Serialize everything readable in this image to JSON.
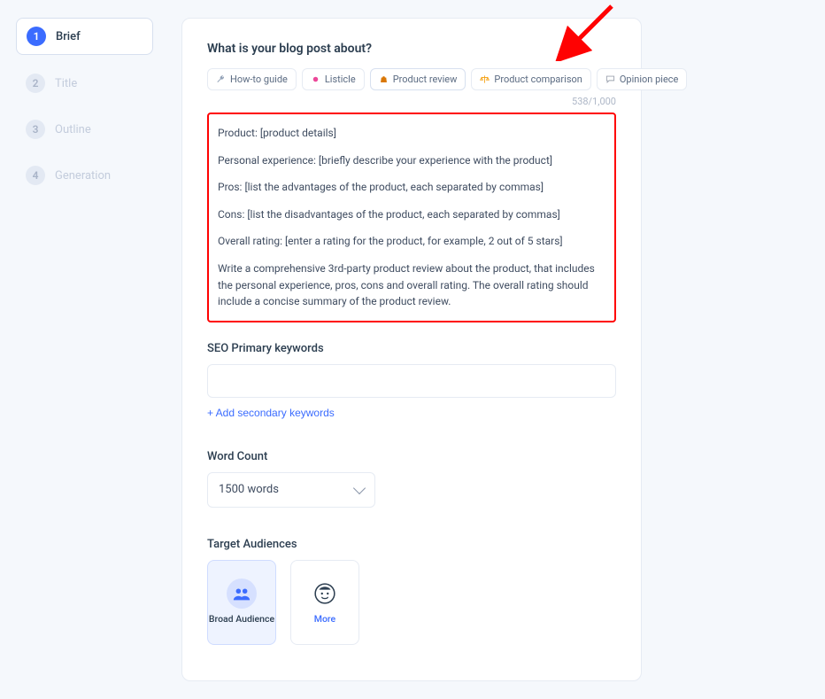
{
  "sidebar": {
    "steps": [
      {
        "num": "1",
        "label": "Brief",
        "active": true
      },
      {
        "num": "2",
        "label": "Title",
        "active": false
      },
      {
        "num": "3",
        "label": "Outline",
        "active": false
      },
      {
        "num": "4",
        "label": "Generation",
        "active": false
      }
    ]
  },
  "brief": {
    "title": "What is your blog post about?",
    "types": [
      {
        "label": "How-to guide",
        "icon": "wrench",
        "color": "#94a3b8"
      },
      {
        "label": "Listicle",
        "icon": "dot",
        "color": "#ec4899"
      },
      {
        "label": "Product review",
        "icon": "bag",
        "color": "#d97706",
        "selected": true
      },
      {
        "label": "Product comparison",
        "icon": "scales",
        "color": "#f59e0b"
      },
      {
        "label": "Opinion piece",
        "icon": "chat",
        "color": "#9ca3af"
      }
    ],
    "char_count": "538/1,000",
    "content": [
      "Product: [product details]",
      "Personal experience: [briefly describe your experience with the product]",
      "Pros: [list the advantages of the product, each separated by commas]",
      "Cons: [list the disadvantages of the product, each separated by commas]",
      "Overall rating: [enter a rating for the product, for example, 2 out of 5 stars]",
      "Write a comprehensive 3rd-party product review about the product, that includes the personal experience, pros, cons and overall rating.  The overall rating should include a concise summary of the product review."
    ]
  },
  "seo": {
    "label": "SEO Primary keywords",
    "value": "",
    "add_link": "+ Add secondary keywords"
  },
  "word_count": {
    "label": "Word Count",
    "selected": "1500 words"
  },
  "audiences": {
    "label": "Target Audiences",
    "cards": [
      {
        "label": "Broad Audience",
        "icon": "group",
        "selected": true
      },
      {
        "label": "More",
        "icon": "face",
        "more": true
      }
    ]
  }
}
